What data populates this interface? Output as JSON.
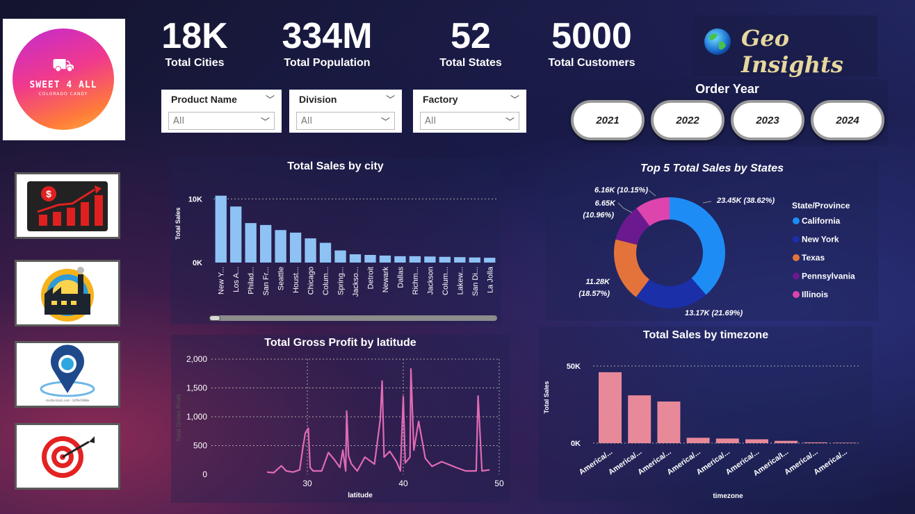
{
  "logo": {
    "title": "SWEET 4 ALL",
    "subtitle": "COLORADO CANDY"
  },
  "nav": [
    {
      "icon": "sales-growth-icon"
    },
    {
      "icon": "factory-icon"
    },
    {
      "icon": "location-pin-icon"
    },
    {
      "icon": "target-icon"
    }
  ],
  "nav_pin_caption": "shutterstock.com · b2f9e5988e",
  "kpis": [
    {
      "value": "18K",
      "label": "Total Cities"
    },
    {
      "value": "334M",
      "label": "Total Population"
    },
    {
      "value": "52",
      "label": "Total States"
    },
    {
      "value": "5000",
      "label": "Total Customers"
    }
  ],
  "brand": {
    "title": "Geo Insights",
    "icon": "globe-icon"
  },
  "slicers": [
    {
      "title": "Product Name",
      "value": "All"
    },
    {
      "title": "Division",
      "value": "All"
    },
    {
      "title": "Factory",
      "value": "All"
    }
  ],
  "order_year": {
    "title": "Order Year",
    "years": [
      "2021",
      "2022",
      "2023",
      "2024"
    ]
  },
  "colors": {
    "bar_blue": "#8ec2f5",
    "pink": "#e8899a",
    "line_pink": "#e06bb5",
    "california": "#1e8cf5",
    "new_york": "#1a2fa8",
    "texas": "#e3733a",
    "pennsylvania": "#6a1a8e",
    "illinois": "#dd44ad"
  },
  "chart_data": [
    {
      "type": "bar",
      "title": "Total Sales by city",
      "ylabel": "Total Sales",
      "yticks": [
        "10K",
        "0K"
      ],
      "ylim": [
        0,
        12000
      ],
      "categories": [
        "New Y...",
        "Los A...",
        "Philad...",
        "San Fr...",
        "Seattle",
        "Houst...",
        "Chicago",
        "Colum...",
        "Spring...",
        "Jackso...",
        "Detroit",
        "Newark",
        "Dallas",
        "Richm...",
        "Jackson",
        "Colum...",
        "Lakew...",
        "San Di...",
        "La Jolla"
      ],
      "values": [
        10500,
        8800,
        6200,
        5900,
        5100,
        4700,
        3800,
        3100,
        1900,
        1300,
        1200,
        1100,
        1000,
        1000,
        950,
        900,
        850,
        800,
        750
      ]
    },
    {
      "type": "pie",
      "title": "Top 5 Total Sales by States",
      "legend_title": "State/Province",
      "legend_position": "right",
      "slices": [
        {
          "name": "California",
          "value": 23.45,
          "label": "23.45K (38.62%)"
        },
        {
          "name": "New York",
          "value": 13.17,
          "label": "13.17K (21.69%)"
        },
        {
          "name": "Texas",
          "value": 11.28,
          "label_line1": "11.28K",
          "label_line2": "(18.57%)"
        },
        {
          "name": "Pennsylvania",
          "value": 6.65,
          "label_line1": "6.65K",
          "label_line2": "(10.96%)"
        },
        {
          "name": "Illinois",
          "value": 6.16,
          "label": "6.16K (10.15%)"
        }
      ]
    },
    {
      "type": "line",
      "title": "Total Gross Profit by latitude",
      "xlabel": "latitude",
      "ylabel": "Total Gross Profit",
      "xlim": [
        20,
        50
      ],
      "ylim": [
        0,
        2000
      ],
      "xticks": [
        30,
        40,
        50
      ],
      "yticks": [
        "0",
        "500",
        "1,000",
        "1,500",
        "2,000"
      ],
      "x": [
        25.8,
        26.5,
        27.3,
        27.8,
        28.5,
        29.2,
        29.5,
        29.8,
        30.1,
        30.3,
        30.6,
        31.5,
        32.2,
        32.8,
        33.4,
        33.7,
        34.0,
        34.1,
        34.3,
        34.6,
        35.2,
        36.0,
        37.0,
        37.6,
        37.8,
        38.0,
        38.6,
        39.3,
        39.7,
        40.0,
        40.2,
        40.7,
        40.8,
        41.1,
        41.6,
        42.3,
        43.0,
        44.0,
        45.5,
        46.5,
        47.6,
        47.8,
        48.2,
        49.0
      ],
      "y": [
        40,
        30,
        150,
        60,
        40,
        80,
        420,
        720,
        800,
        120,
        60,
        60,
        380,
        260,
        120,
        420,
        60,
        1100,
        320,
        180,
        60,
        300,
        180,
        950,
        1620,
        300,
        400,
        220,
        60,
        1350,
        200,
        300,
        1830,
        420,
        920,
        280,
        140,
        220,
        120,
        60,
        60,
        1360,
        60,
        80
      ]
    },
    {
      "type": "bar",
      "title": "Total Sales by timezone",
      "xlabel": "timezone",
      "ylabel": "Total Sales",
      "yticks": [
        "50K",
        "0K"
      ],
      "ylim": [
        0,
        50000
      ],
      "categories": [
        "America/...",
        "America/...",
        "America/...",
        "America/...",
        "America/...",
        "America/...",
        "America/I...",
        "America/...",
        "America/..."
      ],
      "values": [
        46000,
        31000,
        27000,
        3500,
        3000,
        2500,
        1500,
        500,
        300
      ]
    }
  ]
}
